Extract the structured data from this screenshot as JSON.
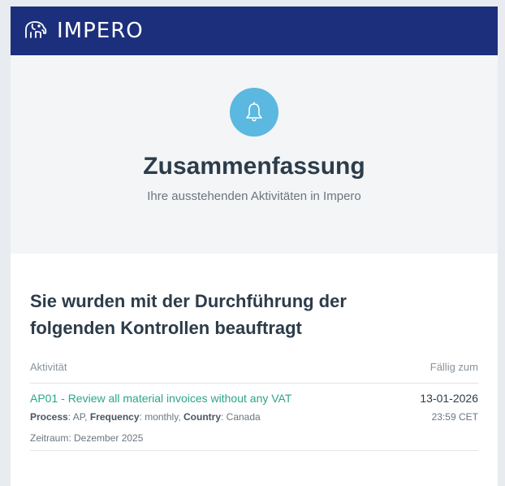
{
  "header": {
    "brand": "IMPERO",
    "logo_icon": "elephant-icon"
  },
  "hero": {
    "icon": "bell-icon",
    "title": "Zusammenfassung",
    "subtitle": "Ihre ausstehenden Aktivitäten in Impero"
  },
  "section": {
    "title": "Sie wurden mit der Durchführung der folgenden Kontrollen beauftragt",
    "col_activity": "Aktivität",
    "col_due": "Fällig zum"
  },
  "rows": [
    {
      "activity": "AP01 - Review all material invoices without any VAT",
      "due_date": "13-01-2026",
      "due_time": "23:59 CET",
      "process_label": "Process",
      "process_value": ": AP, ",
      "frequency_label": "Frequency",
      "frequency_value": ": monthly, ",
      "country_label": "Country",
      "country_value": ": Canada",
      "period": "Zeitraum: Dezember 2025"
    }
  ],
  "colors": {
    "header_bg": "#1c2f7c",
    "bell_bg": "#5bb8e0",
    "link": "#2aa58a"
  }
}
